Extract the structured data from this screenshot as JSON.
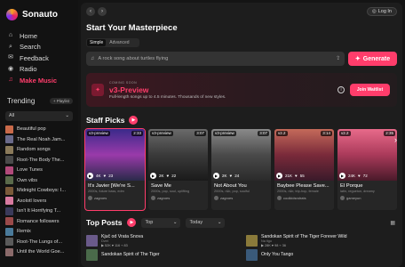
{
  "app": {
    "name": "Sonauto"
  },
  "nav": [
    {
      "label": "Home",
      "icon": "home-icon",
      "glyph": "⌂"
    },
    {
      "label": "Search",
      "icon": "search-icon",
      "glyph": "⌕"
    },
    {
      "label": "Feedback",
      "icon": "feedback-icon",
      "glyph": "✉"
    },
    {
      "label": "Radio",
      "icon": "radio-icon",
      "glyph": "◉"
    },
    {
      "label": "Make Music",
      "icon": "music-icon",
      "glyph": "♫"
    }
  ],
  "trending": {
    "title": "Trending",
    "playlist_btn": "+ Playlist",
    "filter": "All",
    "items": [
      {
        "label": "Beautiful pop",
        "color": "#c96a4a"
      },
      {
        "label": "The Real Noah Jam...",
        "color": "#6a6a8a"
      },
      {
        "label": "Random songs",
        "color": "#8a7a5a"
      },
      {
        "label": "Root-The Body The...",
        "color": "#4a4a4a"
      },
      {
        "label": "Love Tunes",
        "color": "#b24a7a"
      },
      {
        "label": "Own vibs",
        "color": "#5a6a4a"
      },
      {
        "label": "Midnight Cowboys: I...",
        "color": "#7a5a3a"
      },
      {
        "label": "Axolotl lovers",
        "color": "#d87aa0"
      },
      {
        "label": "Isn't It Horrifying T...",
        "color": "#3a3a5a"
      },
      {
        "label": "Romance followers",
        "color": "#9a4a4a"
      },
      {
        "label": "Remix",
        "color": "#4a7a9a"
      },
      {
        "label": "Root-The Lungs of...",
        "color": "#5a5a5a"
      },
      {
        "label": "Until the World Goe...",
        "color": "#8a6a6a"
      }
    ]
  },
  "topbar": {
    "login": "Log In",
    "back": "‹",
    "forward": "›"
  },
  "create": {
    "title": "Start Your Masterpiece",
    "tabs": [
      "Simple",
      "Advanced"
    ],
    "placeholder": "A rock song about turtles flying",
    "generate": "Generate"
  },
  "promo": {
    "small": "COMING SOON",
    "title": "v3-Preview",
    "sub": "Full-length songs up to 4.5 minutes. Thousands of new styles.",
    "button": "Join Waitlist"
  },
  "staff_picks": {
    "title": "Staff Picks",
    "cards": [
      {
        "badge": "v3-preview",
        "duration": "2:33",
        "plays": "4K",
        "likes": "23",
        "title": "It's Javier [We're S...",
        "tags": "2000s, future bass, edm",
        "user": "zagroes",
        "bg": "linear-gradient(180deg,#3a2a8a,#9a3aaa 50%,#2a2a4a)"
      },
      {
        "badge": "v3-preview",
        "duration": "3:07",
        "plays": "2K",
        "likes": "22",
        "title": "Save Me",
        "tags": "2000s, pop, soul, uplifting",
        "user": "zagroes",
        "bg": "linear-gradient(180deg,#6a6a6a,#3a3a3a 50%,#1a1a1a)"
      },
      {
        "badge": "v3-preview",
        "duration": "3:07",
        "plays": "2K",
        "likes": "24",
        "title": "Not About You",
        "tags": "2000s, r&b, pop, soulful",
        "user": "zagroes",
        "bg": "linear-gradient(180deg,#8a8a8a,#4a4a4a 50%,#2a2a2a)"
      },
      {
        "badge": "v2.2",
        "duration": "3:14",
        "plays": "21K",
        "likes": "55",
        "title": "Baybee Please Save...",
        "tags": "2000s, r&b, trip-hop, female",
        "user": "coolkidsndrats",
        "bg": "linear-gradient(180deg,#c46a5a,#7a2a3a 50%,#3a1a2a)"
      },
      {
        "badge": "v2.2",
        "duration": "2:35",
        "plays": "24K",
        "likes": "72",
        "title": "El Porque",
        "tags": "latin, regueton, dreamy",
        "user": "gameyun",
        "bg": "linear-gradient(180deg,#e86a8a,#aa3a5a 50%,#4a1a2a)"
      }
    ]
  },
  "top_posts": {
    "title": "Top Posts",
    "filter1": "Top",
    "filter2": "Today",
    "left": [
      {
        "title": "Kjuč od Vrata Snova",
        "sub": "Dvet",
        "stats": "▶ 52K  ♥ 116  ⌁ 83",
        "color": "#6a5a8a"
      },
      {
        "title": "Sandokan Spirit of The Tiger",
        "sub": "",
        "stats": "",
        "color": "#4a6a4a"
      }
    ],
    "right": [
      {
        "title": "Sandokan Spirit of The Tiger Forever Wild",
        "sub": "Na tigo",
        "stats": "▶ 28K  ♥ 98  ⌁ 36",
        "color": "#8a7a3a"
      },
      {
        "title": "Only You Tango",
        "sub": "",
        "stats": "",
        "color": "#3a5a7a"
      }
    ]
  }
}
